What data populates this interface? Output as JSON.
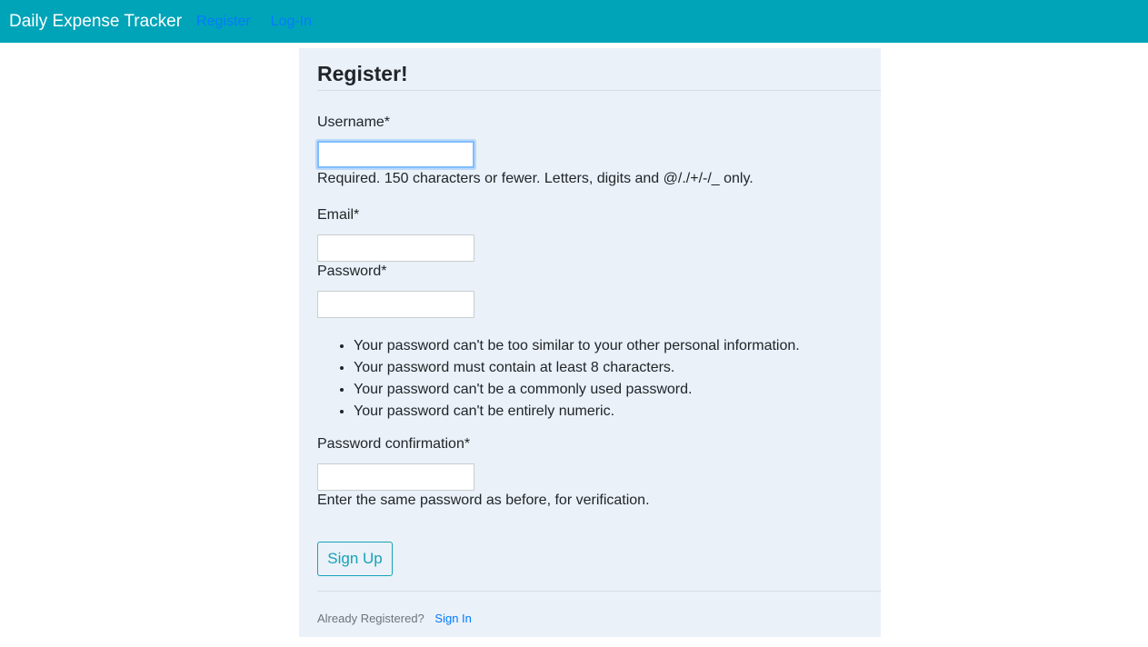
{
  "navbar": {
    "brand": "Daily Expense Tracker",
    "links": [
      "Register",
      "Log-In"
    ]
  },
  "form": {
    "title": "Register!",
    "username": {
      "label": "Username*",
      "value": "",
      "help": "Required. 150 characters or fewer. Letters, digits and @/./+/-/_ only."
    },
    "email": {
      "label": "Email*",
      "value": ""
    },
    "password": {
      "label": "Password*",
      "value": "",
      "rules": [
        "Your password can't be too similar to your other personal information.",
        "Your password must contain at least 8 characters.",
        "Your password can't be a commonly used password.",
        "Your password can't be entirely numeric."
      ]
    },
    "password_confirmation": {
      "label": "Password confirmation*",
      "value": "",
      "help": "Enter the same password as before, for verification."
    },
    "submit_label": "Sign Up"
  },
  "footer": {
    "text": "Already Registered?",
    "link": "Sign In"
  },
  "colors": {
    "navbar": "#00a4b8",
    "panel": "#eaf1f8",
    "link": "#007bff",
    "button_outline": "#17a2b8"
  }
}
